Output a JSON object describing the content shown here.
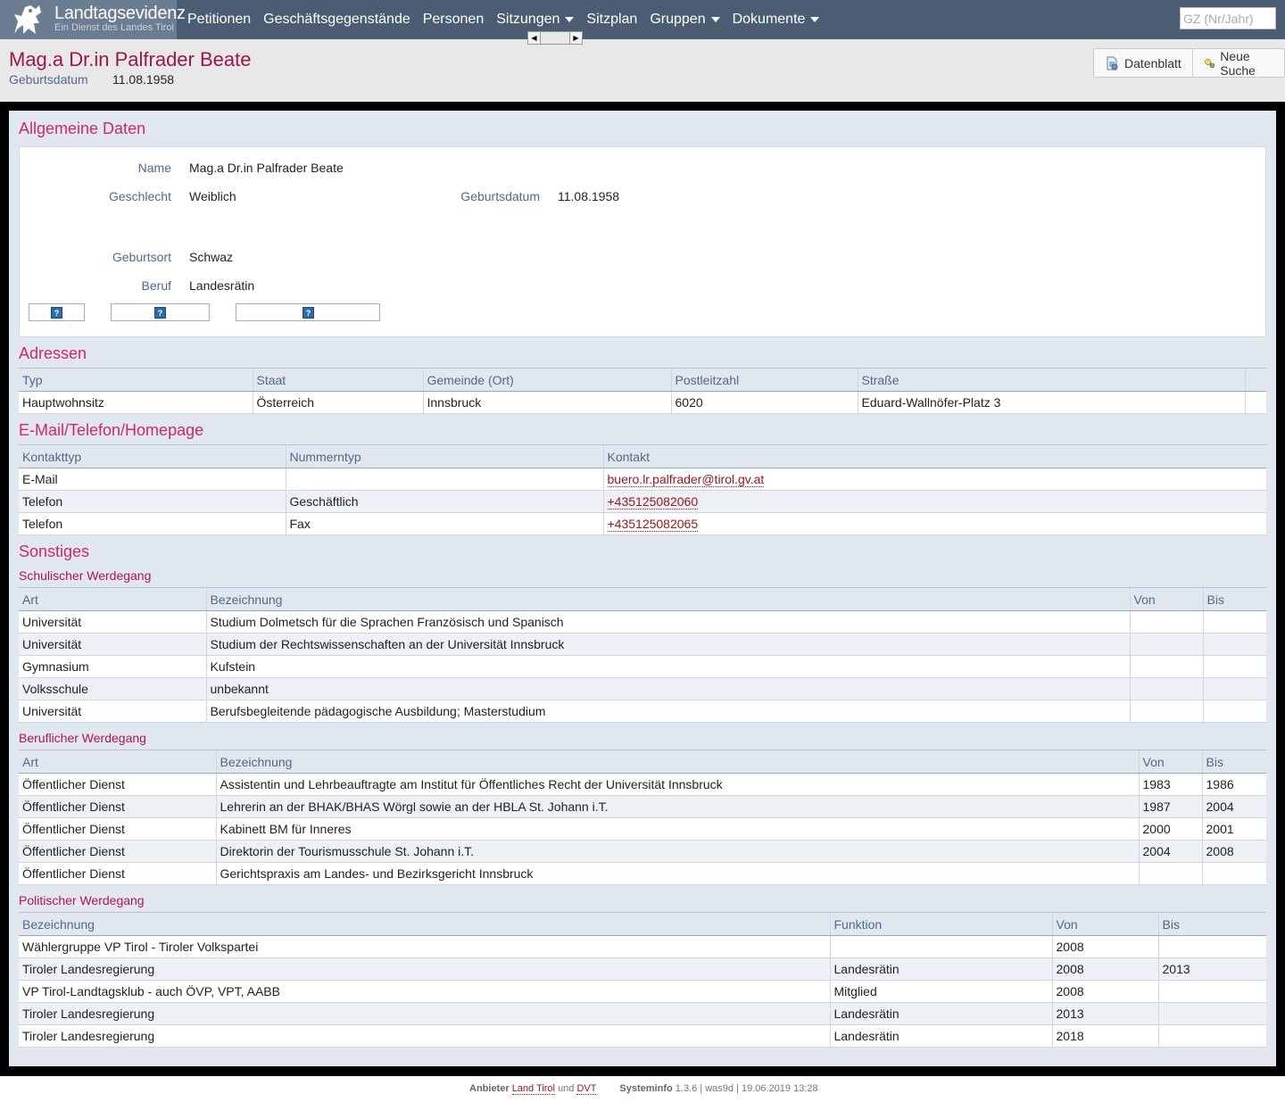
{
  "nav": {
    "brand_title": "Landtagsevidenz",
    "brand_sub": "Ein Dienst des Landes Tirol",
    "items": [
      {
        "label": "Petitionen",
        "dropdown": false
      },
      {
        "label": "Geschäftsgegenstände",
        "dropdown": false
      },
      {
        "label": "Personen",
        "dropdown": false
      },
      {
        "label": "Sitzungen",
        "dropdown": true
      },
      {
        "label": "Sitzplan",
        "dropdown": false
      },
      {
        "label": "Gruppen",
        "dropdown": true
      },
      {
        "label": "Dokumente",
        "dropdown": true
      }
    ],
    "search_placeholder": "GZ (Nr/Jahr)"
  },
  "header": {
    "title": "Mag.a Dr.in Palfrader Beate",
    "birth_label": "Geburtsdatum",
    "birth_value": "11.08.1958",
    "btn_datenblatt": "Datenblatt",
    "btn_neue_suche": "Neue Suche"
  },
  "general": {
    "heading": "Allgemeine Daten",
    "name_label": "Name",
    "name_value": "Mag.a Dr.in Palfrader Beate",
    "gender_label": "Geschlecht",
    "gender_value": "Weiblich",
    "birthdate_label": "Geburtsdatum",
    "birthdate_value": "11.08.1958",
    "birthplace_label": "Geburtsort",
    "birthplace_value": "Schwaz",
    "job_label": "Beruf",
    "job_value": "Landesrätin",
    "help_icon": "?"
  },
  "addresses": {
    "heading": "Adressen",
    "columns": [
      "Typ",
      "Staat",
      "Gemeinde (Ort)",
      "Postleitzahl",
      "Straße"
    ],
    "rows": [
      [
        "Hauptwohnsitz",
        "Österreich",
        "Innsbruck",
        "6020",
        "Eduard-Wallnöfer-Platz 3"
      ]
    ]
  },
  "contacts": {
    "heading": "E-Mail/Telefon/Homepage",
    "columns": [
      "Kontakttyp",
      "Nummerntyp",
      "Kontakt"
    ],
    "rows": [
      [
        "E-Mail",
        "",
        "buero.lr.palfrader@tirol.gv.at"
      ],
      [
        "Telefon",
        "Geschäftlich",
        "+435125082060"
      ],
      [
        "Telefon",
        "Fax",
        "+435125082065"
      ]
    ]
  },
  "misc": {
    "heading": "Sonstiges",
    "school": {
      "heading": "Schulischer Werdegang",
      "columns": [
        "Art",
        "Bezeichnung",
        "Von",
        "Bis"
      ],
      "rows": [
        [
          "Universität",
          "Studium Dolmetsch für die Sprachen Französisch und Spanisch",
          "",
          ""
        ],
        [
          "Universität",
          "Studium der Rechtswissenschaften an der Universität Innsbruck",
          "",
          ""
        ],
        [
          "Gymnasium",
          "Kufstein",
          "",
          ""
        ],
        [
          "Volksschule",
          "unbekannt",
          "",
          ""
        ],
        [
          "Universität",
          "Berufsbegleitende pädagogische Ausbildung; Masterstudium",
          "",
          ""
        ]
      ]
    },
    "career": {
      "heading": "Beruflicher Werdegang",
      "columns": [
        "Art",
        "Bezeichnung",
        "Von",
        "Bis"
      ],
      "rows": [
        [
          "Öffentlicher Dienst",
          "Assistentin und Lehrbeauftragte am Institut für Öffentliches Recht der Universität Innsbruck",
          "1983",
          "1986"
        ],
        [
          "Öffentlicher Dienst",
          "Lehrerin an der BHAK/BHAS Wörgl sowie an der HBLA St. Johann i.T.",
          "1987",
          "2004"
        ],
        [
          "Öffentlicher Dienst",
          "Kabinett BM für Inneres",
          "2000",
          "2001"
        ],
        [
          "Öffentlicher Dienst",
          "Direktorin der Tourismusschule St. Johann i.T.",
          "2004",
          "2008"
        ],
        [
          "Öffentlicher Dienst",
          "Gerichtspraxis am Landes- und Bezirksgericht Innsbruck",
          "",
          ""
        ]
      ]
    },
    "politics": {
      "heading": "Politischer Werdegang",
      "columns": [
        "Bezeichnung",
        "Funktion",
        "Von",
        "Bis"
      ],
      "rows": [
        [
          "Wählergruppe VP Tirol - Tiroler Volkspartei",
          "",
          "2008",
          ""
        ],
        [
          "Tiroler Landesregierung",
          "Landesrätin",
          "2008",
          "2013"
        ],
        [
          "VP Tirol-Landtagsklub - auch ÖVP, VPT, AABB",
          "Mitglied",
          "2008",
          ""
        ],
        [
          "Tiroler Landesregierung",
          "Landesrätin",
          "2013",
          ""
        ],
        [
          "Tiroler Landesregierung",
          "Landesrätin",
          "2018",
          ""
        ]
      ]
    }
  },
  "footer": {
    "provider_label": "Anbieter",
    "provider_1": "Land Tirol",
    "and": "und",
    "provider_2": "DVT",
    "sysinfo_label": "Systeminfo",
    "sysinfo_value": "1.3.6 | was9d | 19.06.2019 13:28"
  },
  "colors": {
    "navbar": "#4a5d73",
    "accent": "#d0266a",
    "label": "#50698a",
    "link": "#a0141e"
  }
}
